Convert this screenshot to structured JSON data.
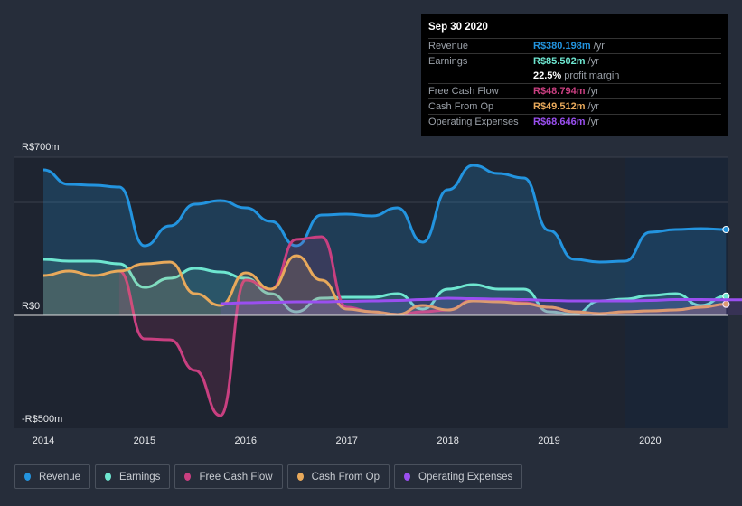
{
  "tooltip": {
    "date": "Sep 30 2020",
    "rows": [
      {
        "label": "Revenue",
        "value": "R$380.198m",
        "unit": " /yr",
        "color": "#2394df"
      },
      {
        "label": "Earnings",
        "value": "R$85.502m",
        "unit": " /yr",
        "color": "#6ee6d0"
      },
      {
        "label": "",
        "value": "22.5%",
        "unit": " profit margin",
        "color": "#ffffff"
      },
      {
        "label": "Free Cash Flow",
        "value": "R$48.794m",
        "unit": " /yr",
        "color": "#c93f80"
      },
      {
        "label": "Cash From Op",
        "value": "R$49.512m",
        "unit": " /yr",
        "color": "#e8a95b"
      },
      {
        "label": "Operating Expenses",
        "value": "R$68.646m",
        "unit": " /yr",
        "color": "#9a4ff0"
      }
    ]
  },
  "legend": [
    {
      "label": "Revenue",
      "color": "#2394df"
    },
    {
      "label": "Earnings",
      "color": "#6ee6d0"
    },
    {
      "label": "Free Cash Flow",
      "color": "#c93f80"
    },
    {
      "label": "Cash From Op",
      "color": "#e8a95b"
    },
    {
      "label": "Operating Expenses",
      "color": "#9a4ff0"
    }
  ],
  "chart_data": {
    "type": "area",
    "ylim": [
      -500,
      700
    ],
    "y_ticks": [
      {
        "v": 700,
        "label": "R$700m"
      },
      {
        "v": 0,
        "label": "R$0"
      },
      {
        "v": -500,
        "label": "-R$500m"
      }
    ],
    "x_ticks": [
      "2014",
      "2015",
      "2016",
      "2017",
      "2018",
      "2019",
      "2020"
    ],
    "xlim": [
      2014,
      2020.75
    ],
    "highlight_from": 2019.75,
    "series": [
      {
        "name": "Revenue",
        "color": "#2394df",
        "x0": 2014,
        "step": 0.25,
        "values": [
          644,
          580,
          576,
          568,
          308,
          396,
          492,
          508,
          476,
          416,
          308,
          444,
          448,
          440,
          476,
          324,
          556,
          664,
          628,
          608,
          376,
          248,
          236,
          240,
          368,
          380,
          384,
          380
        ]
      },
      {
        "name": "Earnings",
        "color": "#6ee6d0",
        "x0": 2014,
        "step": 0.25,
        "values": [
          248,
          240,
          240,
          228,
          124,
          164,
          208,
          192,
          164,
          96,
          16,
          76,
          80,
          80,
          96,
          28,
          116,
          136,
          116,
          116,
          16,
          4,
          64,
          72,
          88,
          96,
          44,
          85
        ]
      },
      {
        "name": "Free Cash Flow",
        "color": "#c93f80",
        "x0": 2014.75,
        "step": 0.25,
        "values": [
          196,
          -104,
          -108,
          -244,
          -444,
          156,
          116,
          336,
          348,
          36,
          16,
          4,
          16,
          24,
          68,
          64,
          56,
          36,
          16,
          8,
          16,
          20,
          24,
          36,
          49
        ]
      },
      {
        "name": "Cash From Op",
        "color": "#e8a95b",
        "x0": 2014,
        "step": 0.25,
        "values": [
          176,
          196,
          176,
          196,
          228,
          236,
          96,
          44,
          188,
          116,
          264,
          156,
          28,
          16,
          4,
          44,
          24,
          64,
          60,
          52,
          36,
          16,
          8,
          16,
          20,
          24,
          36,
          50
        ]
      },
      {
        "name": "Operating Expenses",
        "color": "#9a4ff0",
        "x0": 2015.75,
        "step": 0.25,
        "values": [
          52,
          56,
          58,
          60,
          60,
          62,
          64,
          66,
          70,
          76,
          74,
          72,
          70,
          66,
          64,
          64,
          64,
          66,
          70,
          70,
          69,
          69
        ]
      }
    ]
  }
}
